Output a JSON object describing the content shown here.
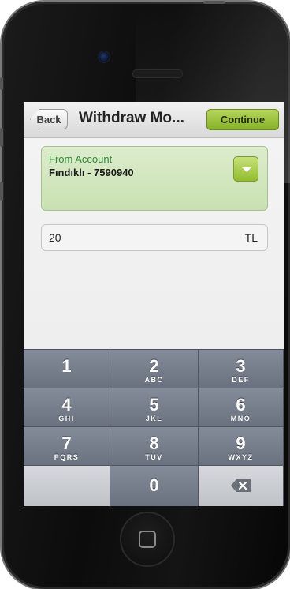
{
  "navbar": {
    "back_label": "Back",
    "title": "Withdraw Mo...",
    "continue_label": "Continue"
  },
  "account": {
    "label": "From Account",
    "value": "Fındıklı - 7590940"
  },
  "amount": {
    "value": "20",
    "unit": "TL"
  },
  "keypad": {
    "k1": {
      "digit": "1",
      "letters": ""
    },
    "k2": {
      "digit": "2",
      "letters": "ABC"
    },
    "k3": {
      "digit": "3",
      "letters": "DEF"
    },
    "k4": {
      "digit": "4",
      "letters": "GHI"
    },
    "k5": {
      "digit": "5",
      "letters": "JKL"
    },
    "k6": {
      "digit": "6",
      "letters": "MNO"
    },
    "k7": {
      "digit": "7",
      "letters": "PQRS"
    },
    "k8": {
      "digit": "8",
      "letters": "TUV"
    },
    "k9": {
      "digit": "9",
      "letters": "WXYZ"
    },
    "k0": {
      "digit": "0",
      "letters": ""
    },
    "delete_icon": "backspace-icon"
  },
  "colors": {
    "continue_button": "#95bd32",
    "account_card": "#cfe5b9",
    "account_label": "#2e8b37",
    "keypad": "#6b7280"
  }
}
